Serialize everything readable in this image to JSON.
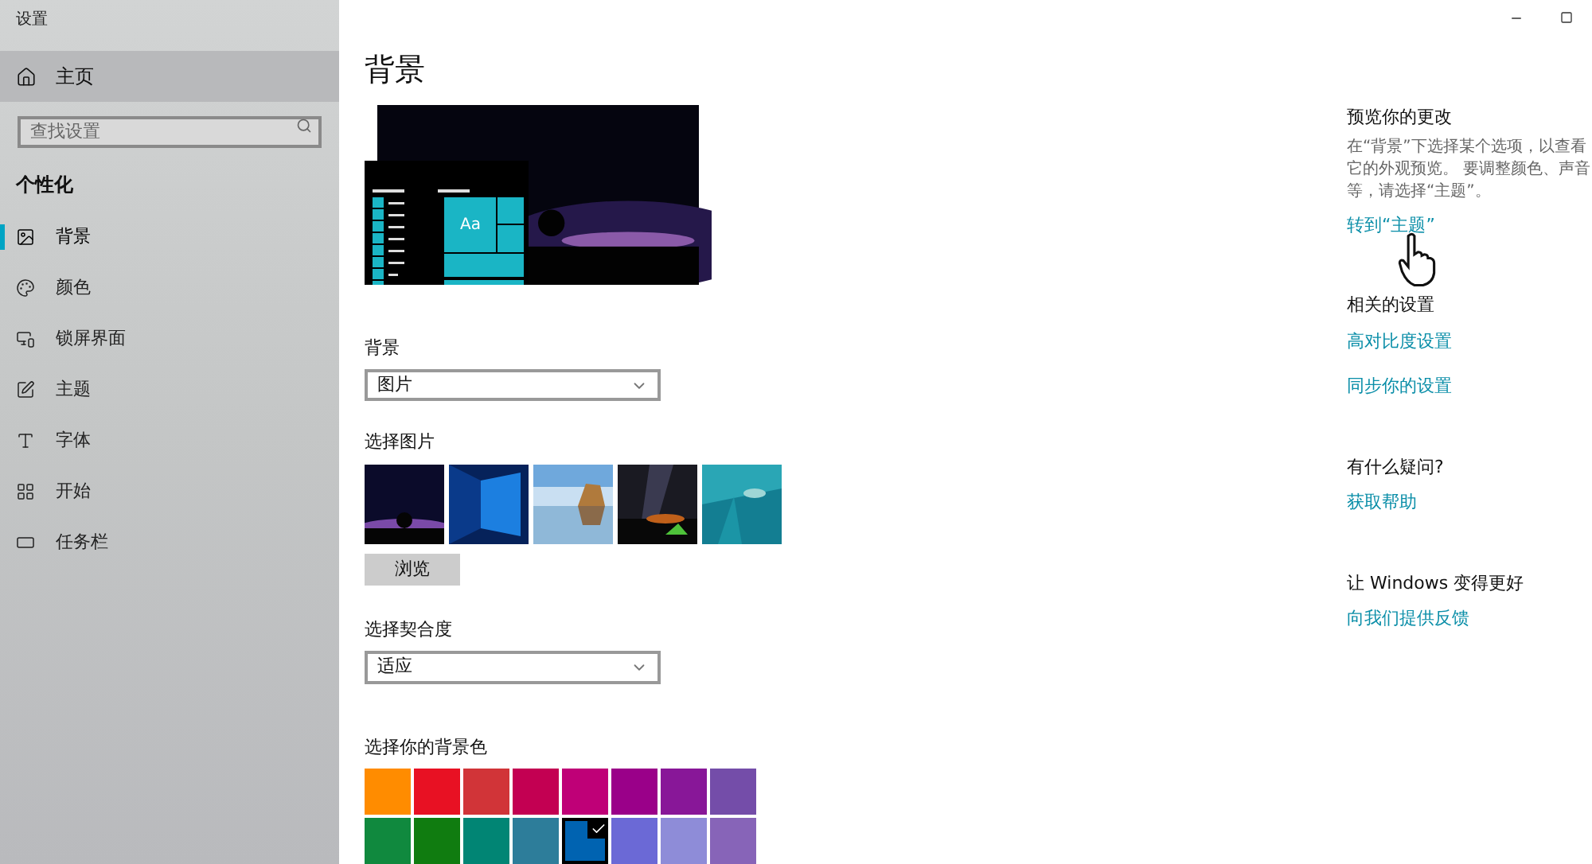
{
  "window": {
    "title": "设置"
  },
  "sidebar": {
    "home": "主页",
    "search": {
      "placeholder": "查找设置"
    },
    "section": "个性化",
    "items": [
      {
        "label": "背景",
        "selected": true
      },
      {
        "label": "颜色",
        "selected": false
      },
      {
        "label": "锁屏界面",
        "selected": false
      },
      {
        "label": "主题",
        "selected": false
      },
      {
        "label": "字体",
        "selected": false
      },
      {
        "label": "开始",
        "selected": false
      },
      {
        "label": "任务栏",
        "selected": false
      }
    ]
  },
  "main": {
    "title": "背景",
    "preview": {
      "tile_text": "Aa"
    },
    "background": {
      "label": "背景",
      "value": "图片"
    },
    "pictures": {
      "label": "选择图片",
      "items": [
        {
          "kind": "night"
        },
        {
          "kind": "windows"
        },
        {
          "kind": "beach"
        },
        {
          "kind": "stars"
        },
        {
          "kind": "underwater"
        }
      ],
      "browse": "浏览"
    },
    "fit": {
      "label": "选择契合度",
      "value": "适应"
    },
    "colors": {
      "label": "选择你的背景色",
      "swatches": [
        {
          "color": "#ff8c00",
          "selected": false
        },
        {
          "color": "#e81123",
          "selected": false
        },
        {
          "color": "#d13438",
          "selected": false
        },
        {
          "color": "#c30052",
          "selected": false
        },
        {
          "color": "#bf0077",
          "selected": false
        },
        {
          "color": "#9a0089",
          "selected": false
        },
        {
          "color": "#881798",
          "selected": false
        },
        {
          "color": "#744da9",
          "selected": false
        },
        {
          "color": "#10893e",
          "selected": false
        },
        {
          "color": "#107c10",
          "selected": false
        },
        {
          "color": "#018574",
          "selected": false
        },
        {
          "color": "#2d7d9a",
          "selected": false
        },
        {
          "color": "#0063b1",
          "selected": true
        },
        {
          "color": "#6b69d6",
          "selected": false
        },
        {
          "color": "#8e8cd8",
          "selected": false
        },
        {
          "color": "#8764b8",
          "selected": false
        }
      ]
    }
  },
  "aside": [
    {
      "heading": "预览你的更改",
      "text": "在“背景”下选择某个选项，以查看它的外观预览。 要调整颜色、声音等，请选择“主题”。",
      "links": [
        "转到“主题”"
      ]
    },
    {
      "heading": "相关的设置",
      "links": [
        "高对比度设置",
        "同步你的设置"
      ]
    },
    {
      "heading": "有什么疑问?",
      "links": [
        "获取帮助"
      ]
    },
    {
      "heading": "让 Windows 变得更好",
      "links": [
        "向我们提供反馈"
      ]
    }
  ]
}
